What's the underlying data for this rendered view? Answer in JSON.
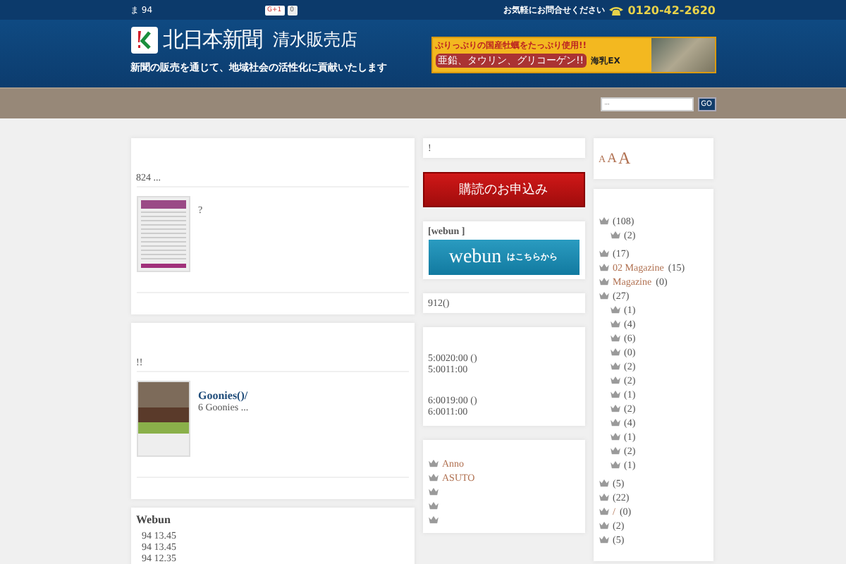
{
  "topbar": {
    "note": "ま 94",
    "share_buttons": [
      "G+1",
      "0"
    ],
    "contact_label": "お気軽にお問合せください",
    "phone": "0120-42-2620"
  },
  "header": {
    "brand": "北日本新聞",
    "store": "清水販売店",
    "tagline": "新聞の販売を通じて、地域社会の活性化に貢献いたします",
    "ad": {
      "headline": "ぷりっぷりの国産牡蠣をたっぷり使用!!",
      "subline": "亜鉛、タウリン、グリコーゲン!!",
      "product": "海乳EX"
    }
  },
  "search": {
    "placeholder": "...",
    "button": "GO"
  },
  "main": [
    {
      "kind": "post",
      "intro": "824  ...",
      "entry_text": "?",
      "thumb": {
        "kind": "flyer"
      }
    },
    {
      "kind": "post",
      "intro": "!!",
      "entry_title": "Goonies()/",
      "entry_text": "6 Goonies  ...",
      "thumb": {
        "kind": "photo"
      }
    },
    {
      "kind": "list",
      "title": "Webun",
      "items": [
        "94 13.45",
        "94 13.45",
        "94 12.35"
      ]
    }
  ],
  "middle": [
    {
      "kind": "text",
      "lines": [
        "!"
      ]
    },
    {
      "kind": "red_button",
      "label": "購読のお申込み"
    },
    {
      "kind": "webun",
      "title": "[webun ]",
      "logo": "webun",
      "sub": "はこちらから"
    },
    {
      "kind": "text",
      "lines": [
        "912()"
      ]
    },
    {
      "kind": "hours",
      "groups": [
        [
          "5:0020:00 ()",
          "5:0011:00"
        ],
        [
          "6:0019:00 ()",
          "6:0011:00"
        ]
      ]
    },
    {
      "kind": "links",
      "items": [
        {
          "kind": "link",
          "text": "Anno"
        },
        {
          "kind": "link",
          "text": "ASUTO"
        },
        {
          "kind": "blank"
        },
        {
          "kind": "blank"
        },
        {
          "kind": "blank"
        }
      ]
    }
  ],
  "font_sizes": [
    "A",
    "A",
    "A"
  ],
  "categories": [
    {
      "count": "(108)",
      "children": [
        {
          "count": "(2)"
        }
      ]
    },
    {
      "count": "(17)"
    },
    {
      "label": "02 Magazine",
      "count": "(15)"
    },
    {
      "label": "Magazine",
      "count": "(0)"
    },
    {
      "count": "(27)",
      "children": [
        {
          "count": "(1)"
        },
        {
          "count": "(4)"
        },
        {
          "count": "(6)"
        },
        {
          "count": "(0)"
        },
        {
          "count": "(2)"
        },
        {
          "count": "(2)"
        },
        {
          "count": "(1)"
        },
        {
          "count": "(2)"
        },
        {
          "count": "(4)"
        },
        {
          "count": "(1)"
        },
        {
          "count": "(2)"
        },
        {
          "count": "(1)"
        }
      ]
    },
    {
      "count": "(5)"
    },
    {
      "count": "(22)"
    },
    {
      "label": "/",
      "count": "(0)"
    },
    {
      "count": "(2)"
    },
    {
      "count": "(5)"
    }
  ]
}
